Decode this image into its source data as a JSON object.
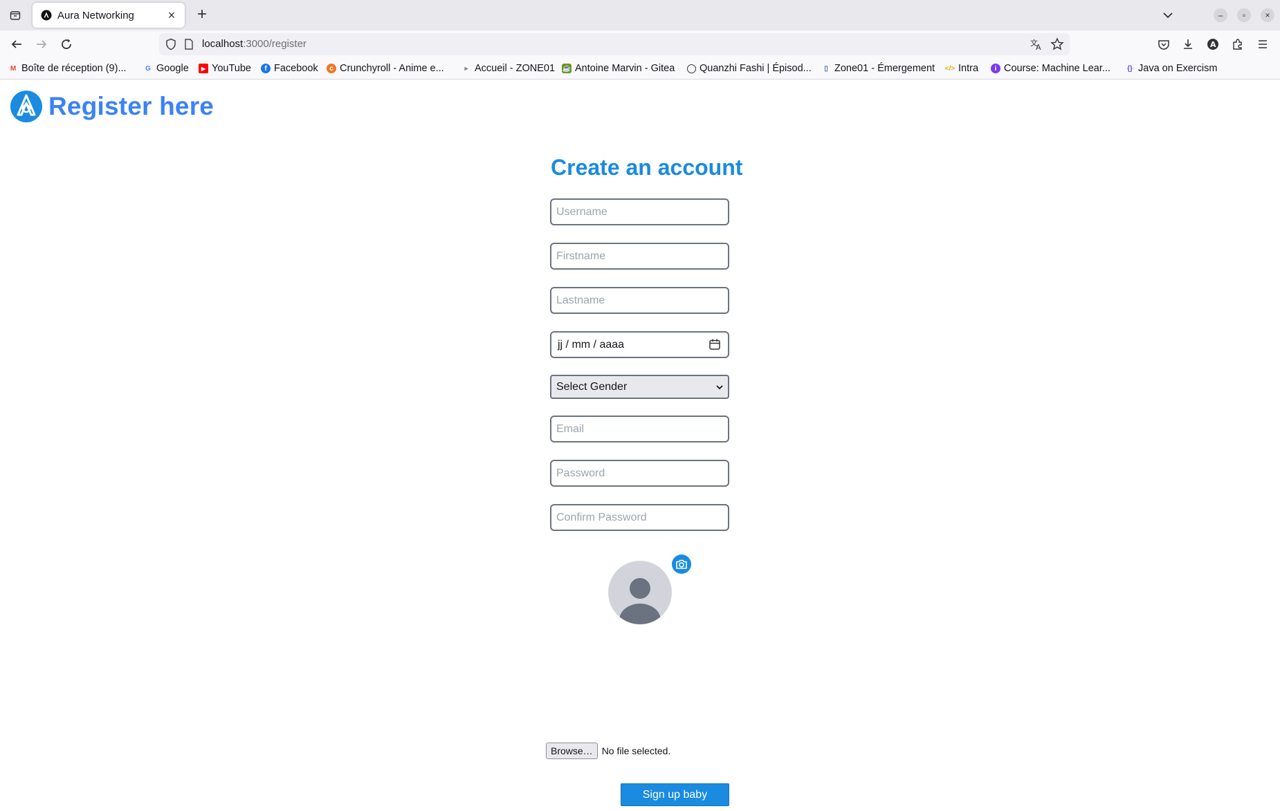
{
  "browser": {
    "tab_title": "Aura Networking",
    "url_host": "localhost",
    "url_path": ":3000/register",
    "bookmarks": [
      {
        "label": "Boîte de réception (9)...",
        "icon": "gmail-icon",
        "color": "#ea4335"
      },
      {
        "label": "Google",
        "icon": "google-icon",
        "color": "#4285f4"
      },
      {
        "label": "YouTube",
        "icon": "youtube-icon",
        "color": "#ff0000"
      },
      {
        "label": "Facebook",
        "icon": "facebook-icon",
        "color": "#1877f2"
      },
      {
        "label": "Crunchyroll - Anime e...",
        "icon": "crunchyroll-icon",
        "color": "#f47521"
      },
      {
        "label": "Accueil - ZONE01",
        "icon": "zone01-icon",
        "color": "#888888"
      },
      {
        "label": "Antoine Marvin - Gitea",
        "icon": "gitea-icon",
        "color": "#609926"
      },
      {
        "label": "Quanzhi Fashi | Épisod...",
        "icon": "globe-icon",
        "color": "#333333"
      },
      {
        "label": "Zone01 - Émergement",
        "icon": "zone01-icon",
        "color": "#4a6fa5"
      },
      {
        "label": "Intra",
        "icon": "code-icon",
        "color": "#e6a700"
      },
      {
        "label": "Course: Machine Lear...",
        "icon": "course-icon",
        "color": "#7c3aed"
      },
      {
        "label": "Java on Exercism",
        "icon": "exercism-icon",
        "color": "#604fcd"
      }
    ]
  },
  "page": {
    "brand_title": "Register here",
    "form_title": "Create an account",
    "fields": {
      "username_placeholder": "Username",
      "firstname_placeholder": "Firstname",
      "lastname_placeholder": "Lastname",
      "date_placeholder": "jj / mm / aaaa",
      "gender_selected": "Select Gender",
      "email_placeholder": "Email",
      "password_placeholder": "Password",
      "confirm_password_placeholder": "Confirm Password"
    },
    "file_input": {
      "browse_label": "Browse…",
      "status": "No file selected."
    },
    "submit_label": "Sign up baby",
    "colors": {
      "brand_blue": "#3b82f6",
      "accent_blue": "#1a8be0",
      "field_border": "#6b7280"
    }
  }
}
